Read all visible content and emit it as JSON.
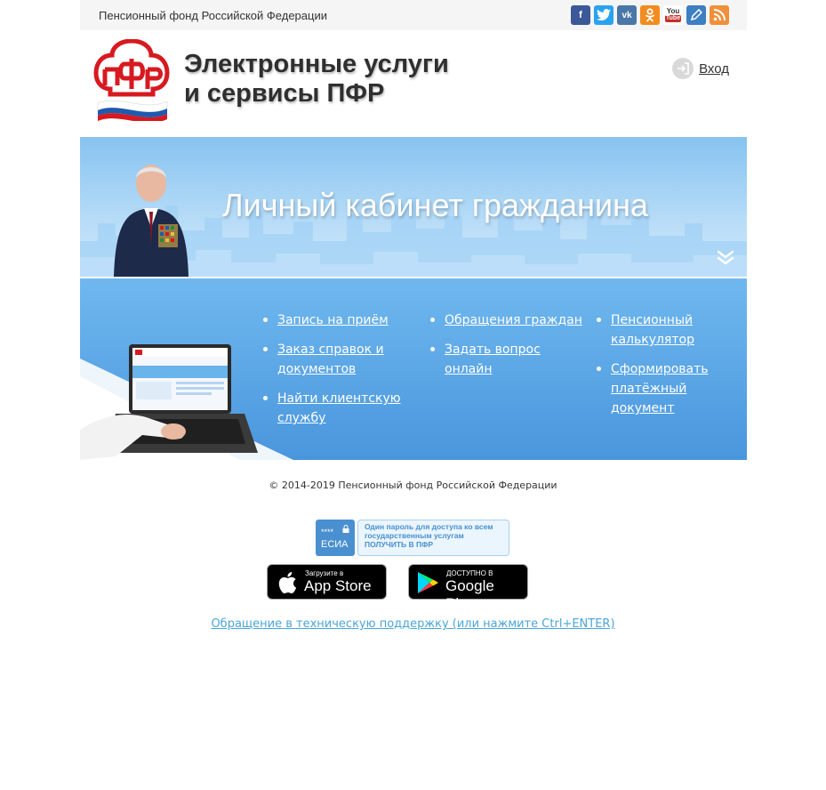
{
  "topbar": {
    "org_name": "Пенсионный фонд Российской Федерации",
    "social": [
      {
        "name": "facebook-icon",
        "glyph": "f",
        "color": "#3b5998"
      },
      {
        "name": "twitter-icon",
        "glyph": "t",
        "color": "#2aa3ef"
      },
      {
        "name": "vk-icon",
        "glyph": "vk",
        "color": "#4a76a8"
      },
      {
        "name": "odnoklassniki-icon",
        "glyph": "ok",
        "color": "#f28c1f"
      },
      {
        "name": "youtube-icon",
        "glyph": "You",
        "color": "#c4302b"
      },
      {
        "name": "livejournal-icon",
        "glyph": "✎",
        "color": "#3d7fc1"
      },
      {
        "name": "rss-icon",
        "glyph": "))",
        "color": "#f1903b"
      }
    ]
  },
  "header": {
    "title": "Электронные услуги\nи сервисы ПФР",
    "login_label": "Вход"
  },
  "banner": {
    "title": "Личный кабинет гражданина"
  },
  "services": {
    "columns": [
      [
        "Запись на приём",
        "Заказ справок и документов",
        "Найти клиентскую службу"
      ],
      [
        "Обращения граждан",
        "Задать вопрос онлайн"
      ],
      [
        "Пенсионный калькулятор",
        "Сформировать платёжный документ"
      ]
    ]
  },
  "footer": {
    "copyright": "© 2014-2019 Пенсионный фонд Российской Федерации",
    "esia_left": "ЕСИА",
    "esia_stars": "****",
    "esia_text_1": "Один пароль для доступа ко всем",
    "esia_text_2": "государственным услугам",
    "esia_text_3": "ПОЛУЧИТЬ В ПФР",
    "appstore_small": "Загрузите в",
    "appstore_big": "App Store",
    "googleplay_small": "ДОСТУПНО В",
    "googleplay_big": "Google Play",
    "support_link": "Обращение в техническую поддержку (или нажмите Ctrl+ENTER)"
  }
}
